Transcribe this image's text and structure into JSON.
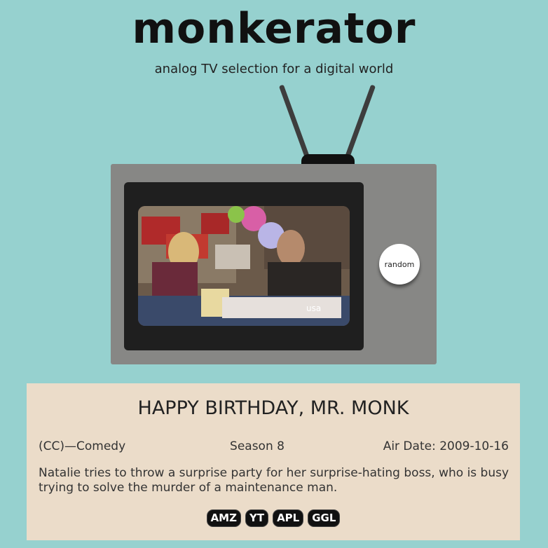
{
  "header": {
    "logo": "monkerator",
    "tagline": "analog TV selection for a digital world"
  },
  "tv": {
    "random_label": "random",
    "screen_watermark": "usa"
  },
  "episode": {
    "title": "HAPPY BIRTHDAY, MR. MONK",
    "rating_genre": "(CC)—Comedy",
    "season": "Season 8",
    "air_date": "Air Date: 2009-10-16",
    "description": "Natalie tries to throw a surprise party for her surprise-hating boss, who is busy trying to solve the murder of a maintenance man."
  },
  "links": [
    "AMZ",
    "YT",
    "APL",
    "GGL"
  ],
  "colors": {
    "background": "#96d1cf",
    "tv_body": "#878785",
    "info_panel": "#ebdcc9"
  }
}
